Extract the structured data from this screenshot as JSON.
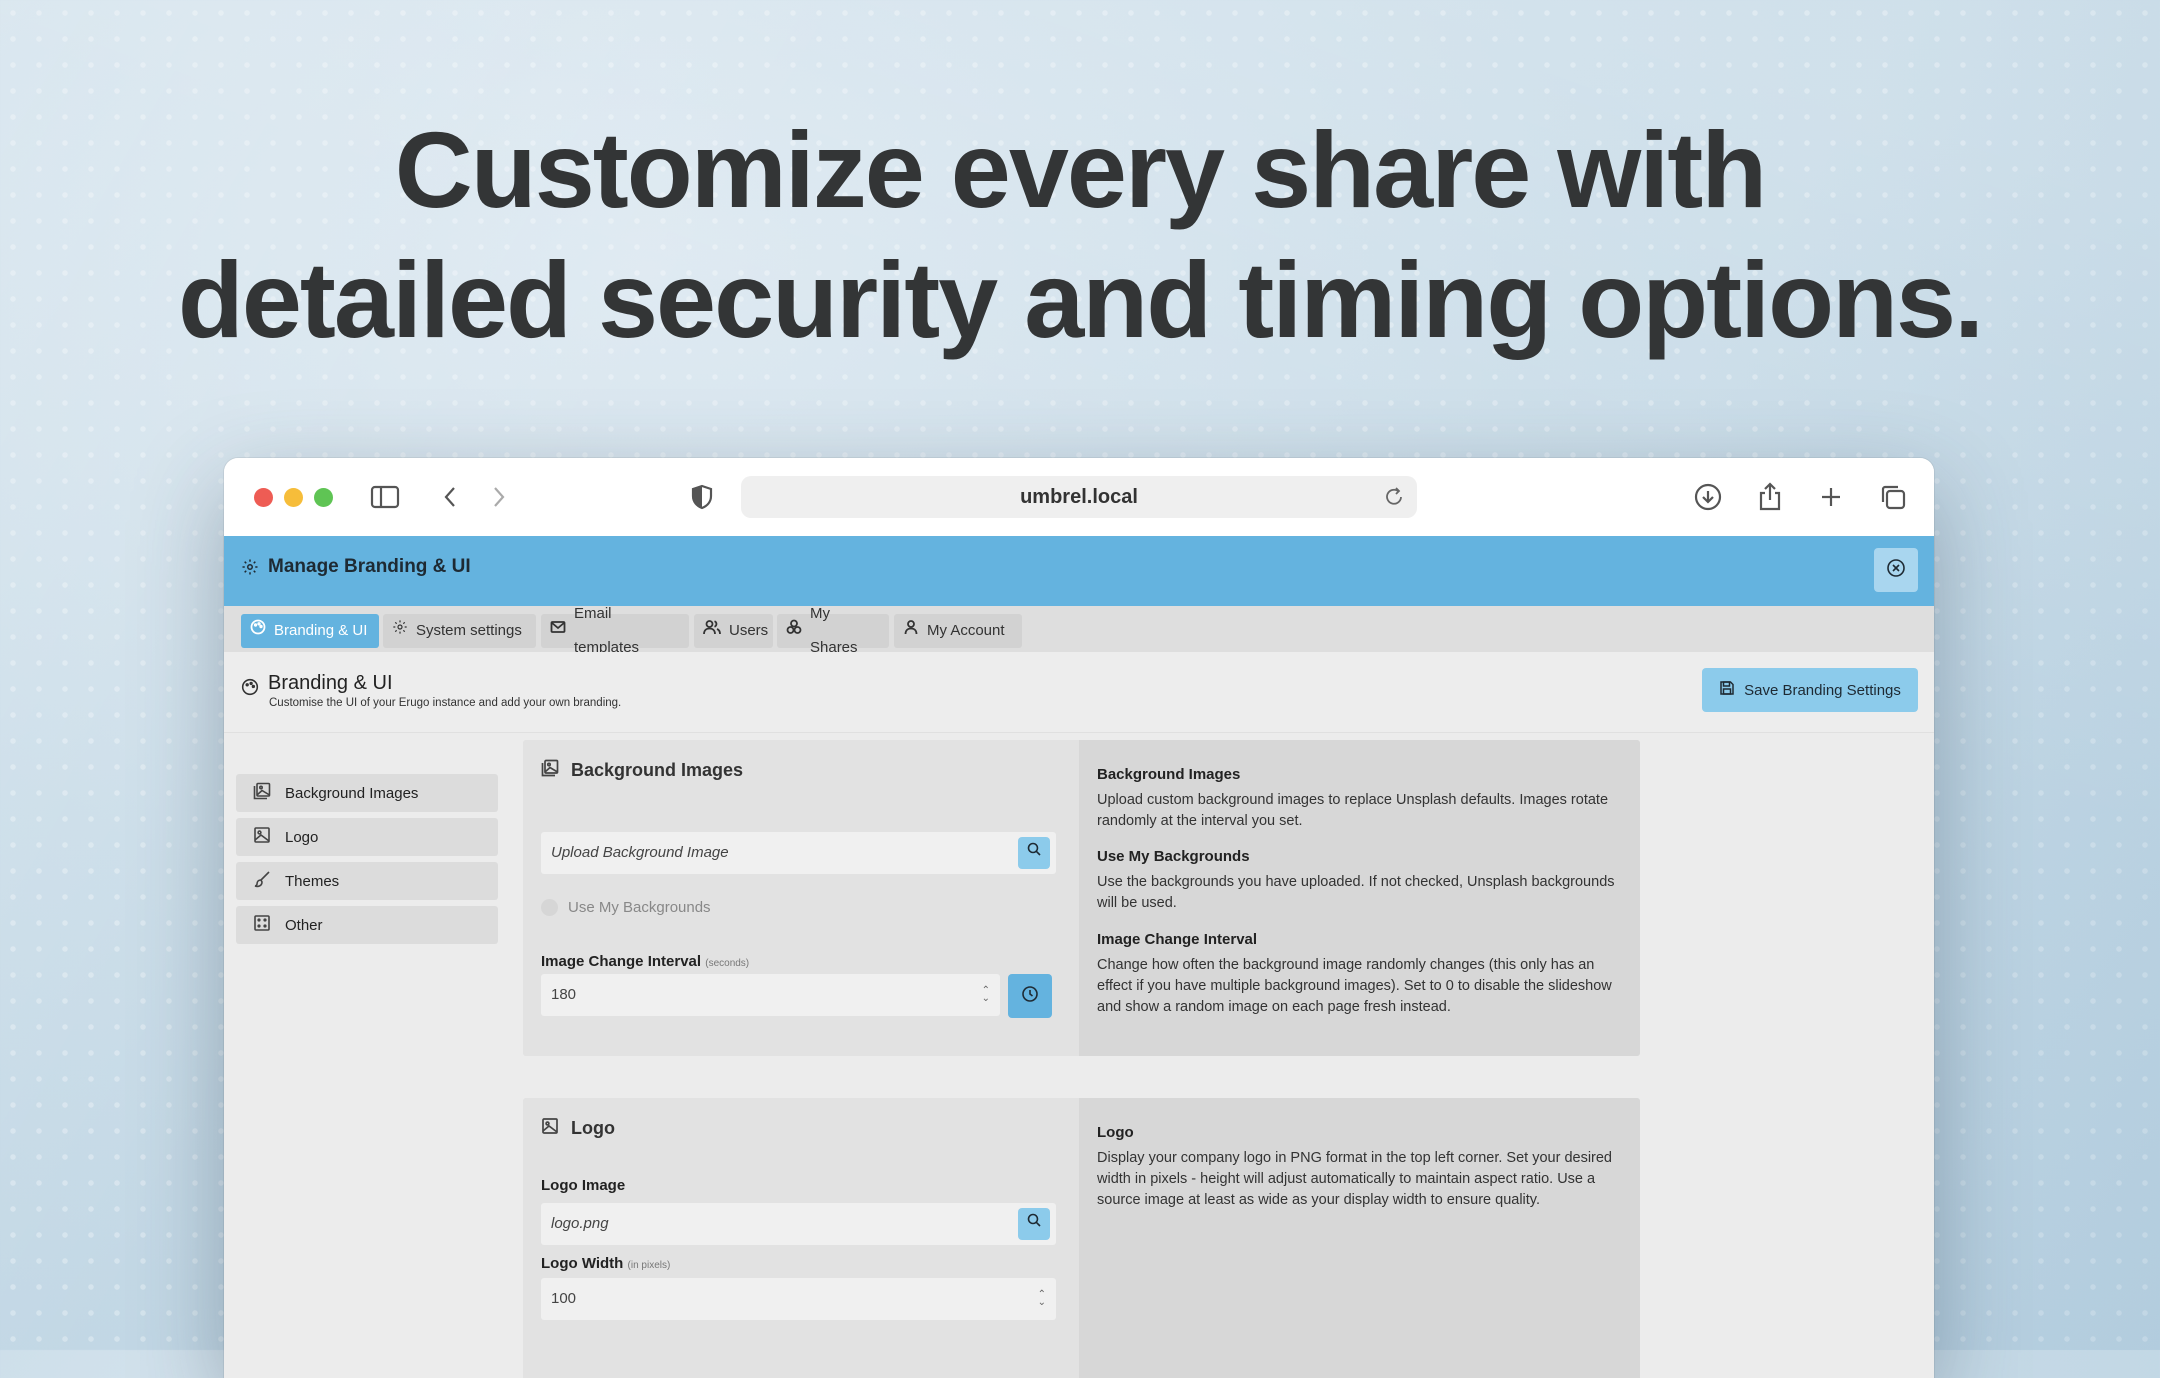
{
  "headline": {
    "line1": "Customize every share with",
    "line2": "detailed security and timing options."
  },
  "browser": {
    "url": "umbrel.local",
    "icons": [
      "sidebar-icon",
      "back-icon",
      "forward-icon",
      "shield-icon",
      "reload-icon",
      "download-icon",
      "share-icon",
      "new-tab-icon",
      "tabs-overview-icon"
    ]
  },
  "app": {
    "header_title": "Manage Branding & UI",
    "accent_color": "#64b3df",
    "tabs": [
      {
        "label": "Branding & UI",
        "icon": "palette-icon",
        "active": true
      },
      {
        "label": "System settings",
        "icon": "gear-icon"
      },
      {
        "label": "Email templates",
        "icon": "mail-icon"
      },
      {
        "label": "Users",
        "icon": "users-icon"
      },
      {
        "label": "My Shares",
        "icon": "share-nodes-icon"
      },
      {
        "label": "My Account",
        "icon": "user-icon"
      }
    ],
    "page_title": "Branding & UI",
    "page_subtitle": "Customise the UI of your Erugo instance and add your own branding.",
    "save_button": "Save Branding Settings"
  },
  "sidenav": [
    {
      "label": "Background Images",
      "icon": "images-icon"
    },
    {
      "label": "Logo",
      "icon": "image-icon"
    },
    {
      "label": "Themes",
      "icon": "brush-icon"
    },
    {
      "label": "Other",
      "icon": "grid-icon"
    }
  ],
  "bg_card": {
    "title": "Background Images",
    "upload_placeholder": "Upload Background Image",
    "use_my_backgrounds": "Use My Backgrounds",
    "interval_label": "Image Change Interval",
    "interval_unit": "(seconds)",
    "interval_value": "180",
    "help": [
      {
        "heading": "Background Images",
        "text": "Upload custom background images to replace Unsplash defaults. Images rotate randomly at the interval you set."
      },
      {
        "heading": "Use My Backgrounds",
        "text": "Use the backgrounds you have uploaded. If not checked, Unsplash backgrounds will be used."
      },
      {
        "heading": "Image Change Interval",
        "text": "Change how often the background image randomly changes (this only has an effect if you have multiple background images). Set to 0 to disable the slideshow and show a random image on each page fresh instead."
      }
    ]
  },
  "logo_card": {
    "title": "Logo",
    "logo_image_label": "Logo Image",
    "logo_image_value": "logo.png",
    "logo_width_label": "Logo Width",
    "logo_width_unit": "(in pixels)",
    "logo_width_value": "100",
    "help": [
      {
        "heading": "Logo",
        "text": "Display your company logo in PNG format in the top left corner. Set your desired width in pixels - height will adjust automatically to maintain aspect ratio. Use a source image at least as wide as your display width to ensure quality."
      }
    ]
  }
}
